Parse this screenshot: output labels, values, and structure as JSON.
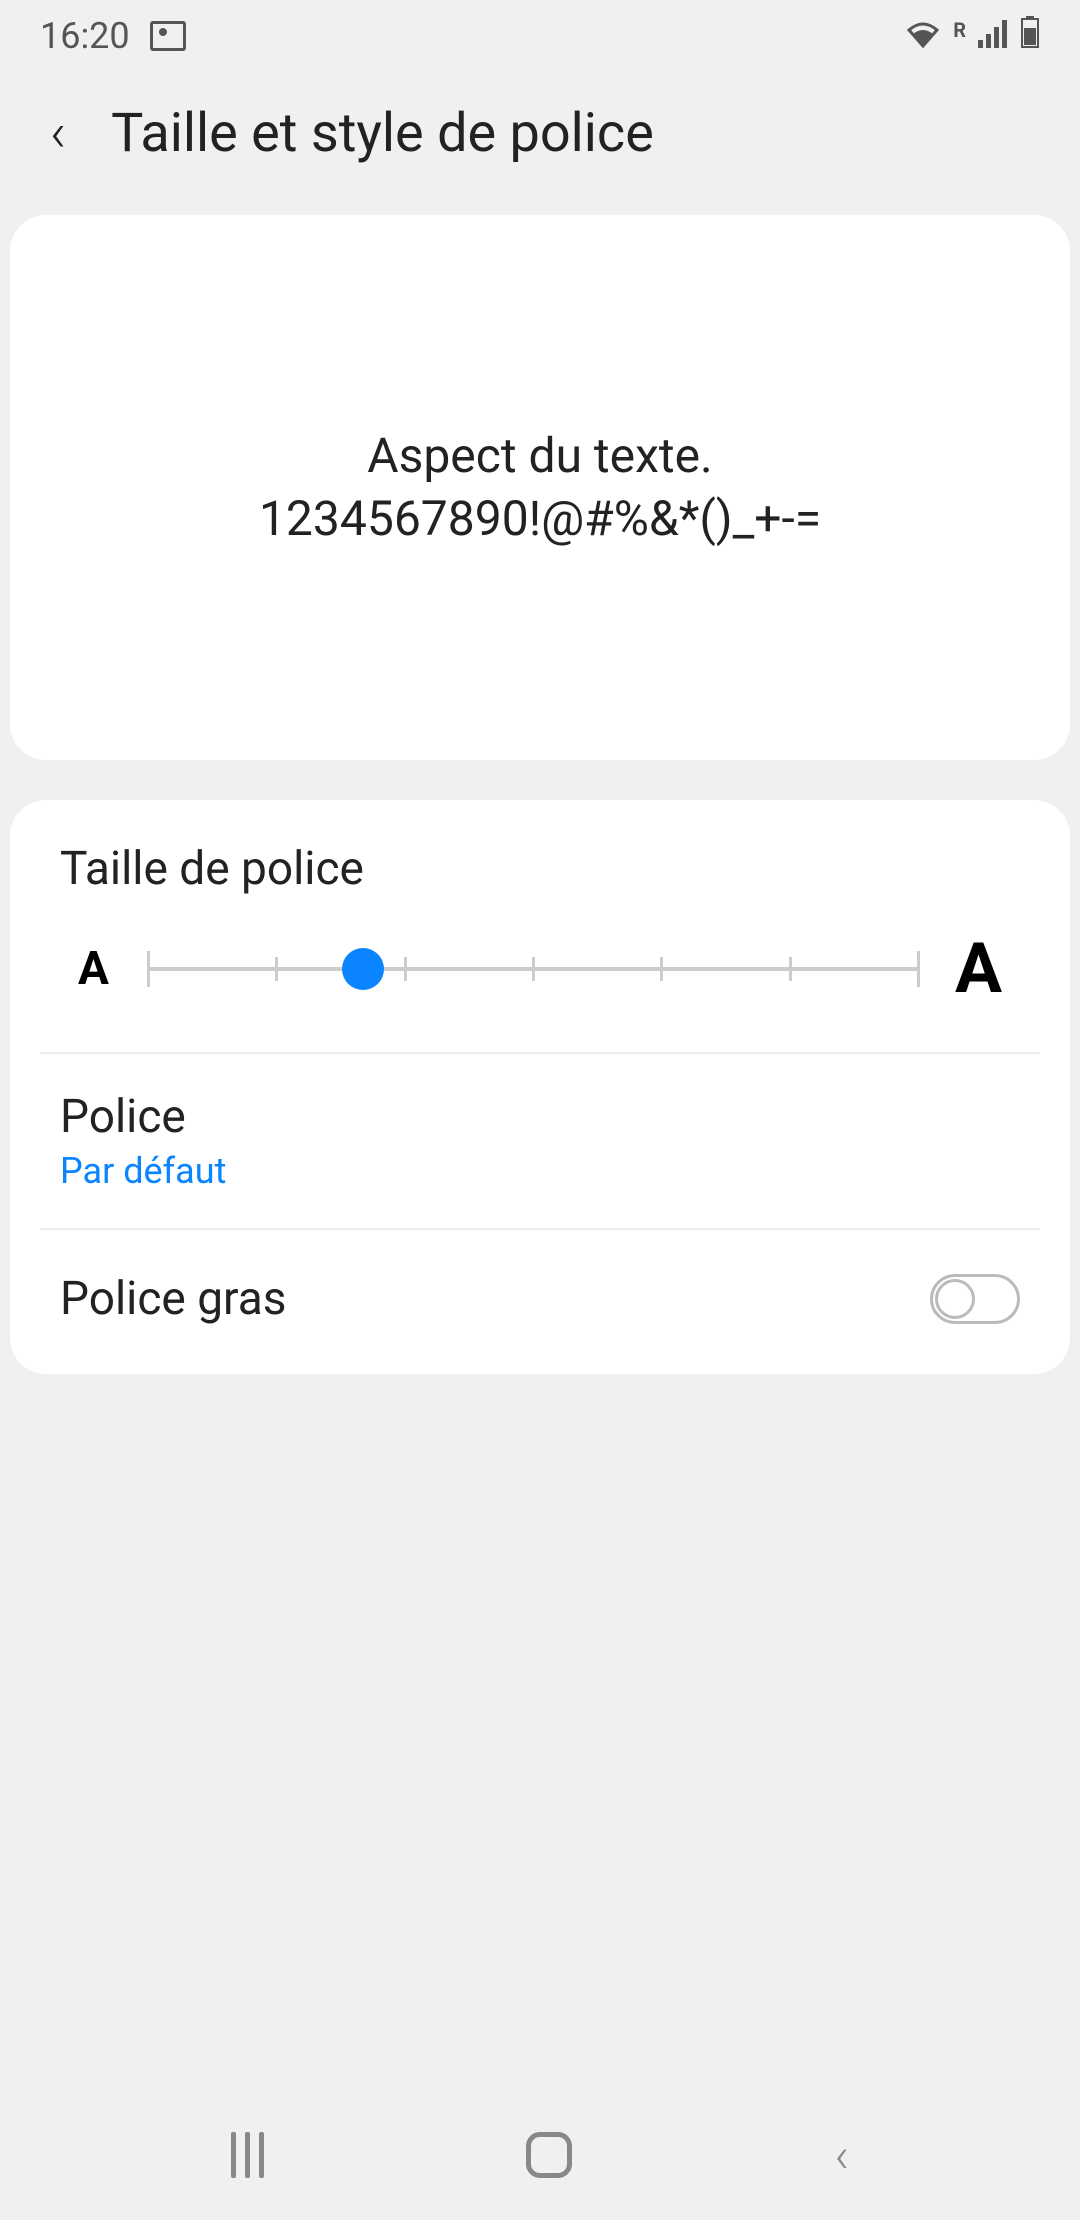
{
  "status_bar": {
    "time": "16:20",
    "roaming": "R"
  },
  "header": {
    "title": "Taille et style de police"
  },
  "preview": {
    "line1": "Aspect du texte.",
    "line2": "1234567890!@#%&*()_+-="
  },
  "font_size": {
    "label": "Taille de police",
    "small_indicator": "A",
    "large_indicator": "A",
    "steps": 7,
    "current_step": 2
  },
  "font_style": {
    "label": "Police",
    "value": "Par défaut"
  },
  "bold_font": {
    "label": "Police gras",
    "enabled": false
  },
  "colors": {
    "accent": "#0a84ff"
  }
}
